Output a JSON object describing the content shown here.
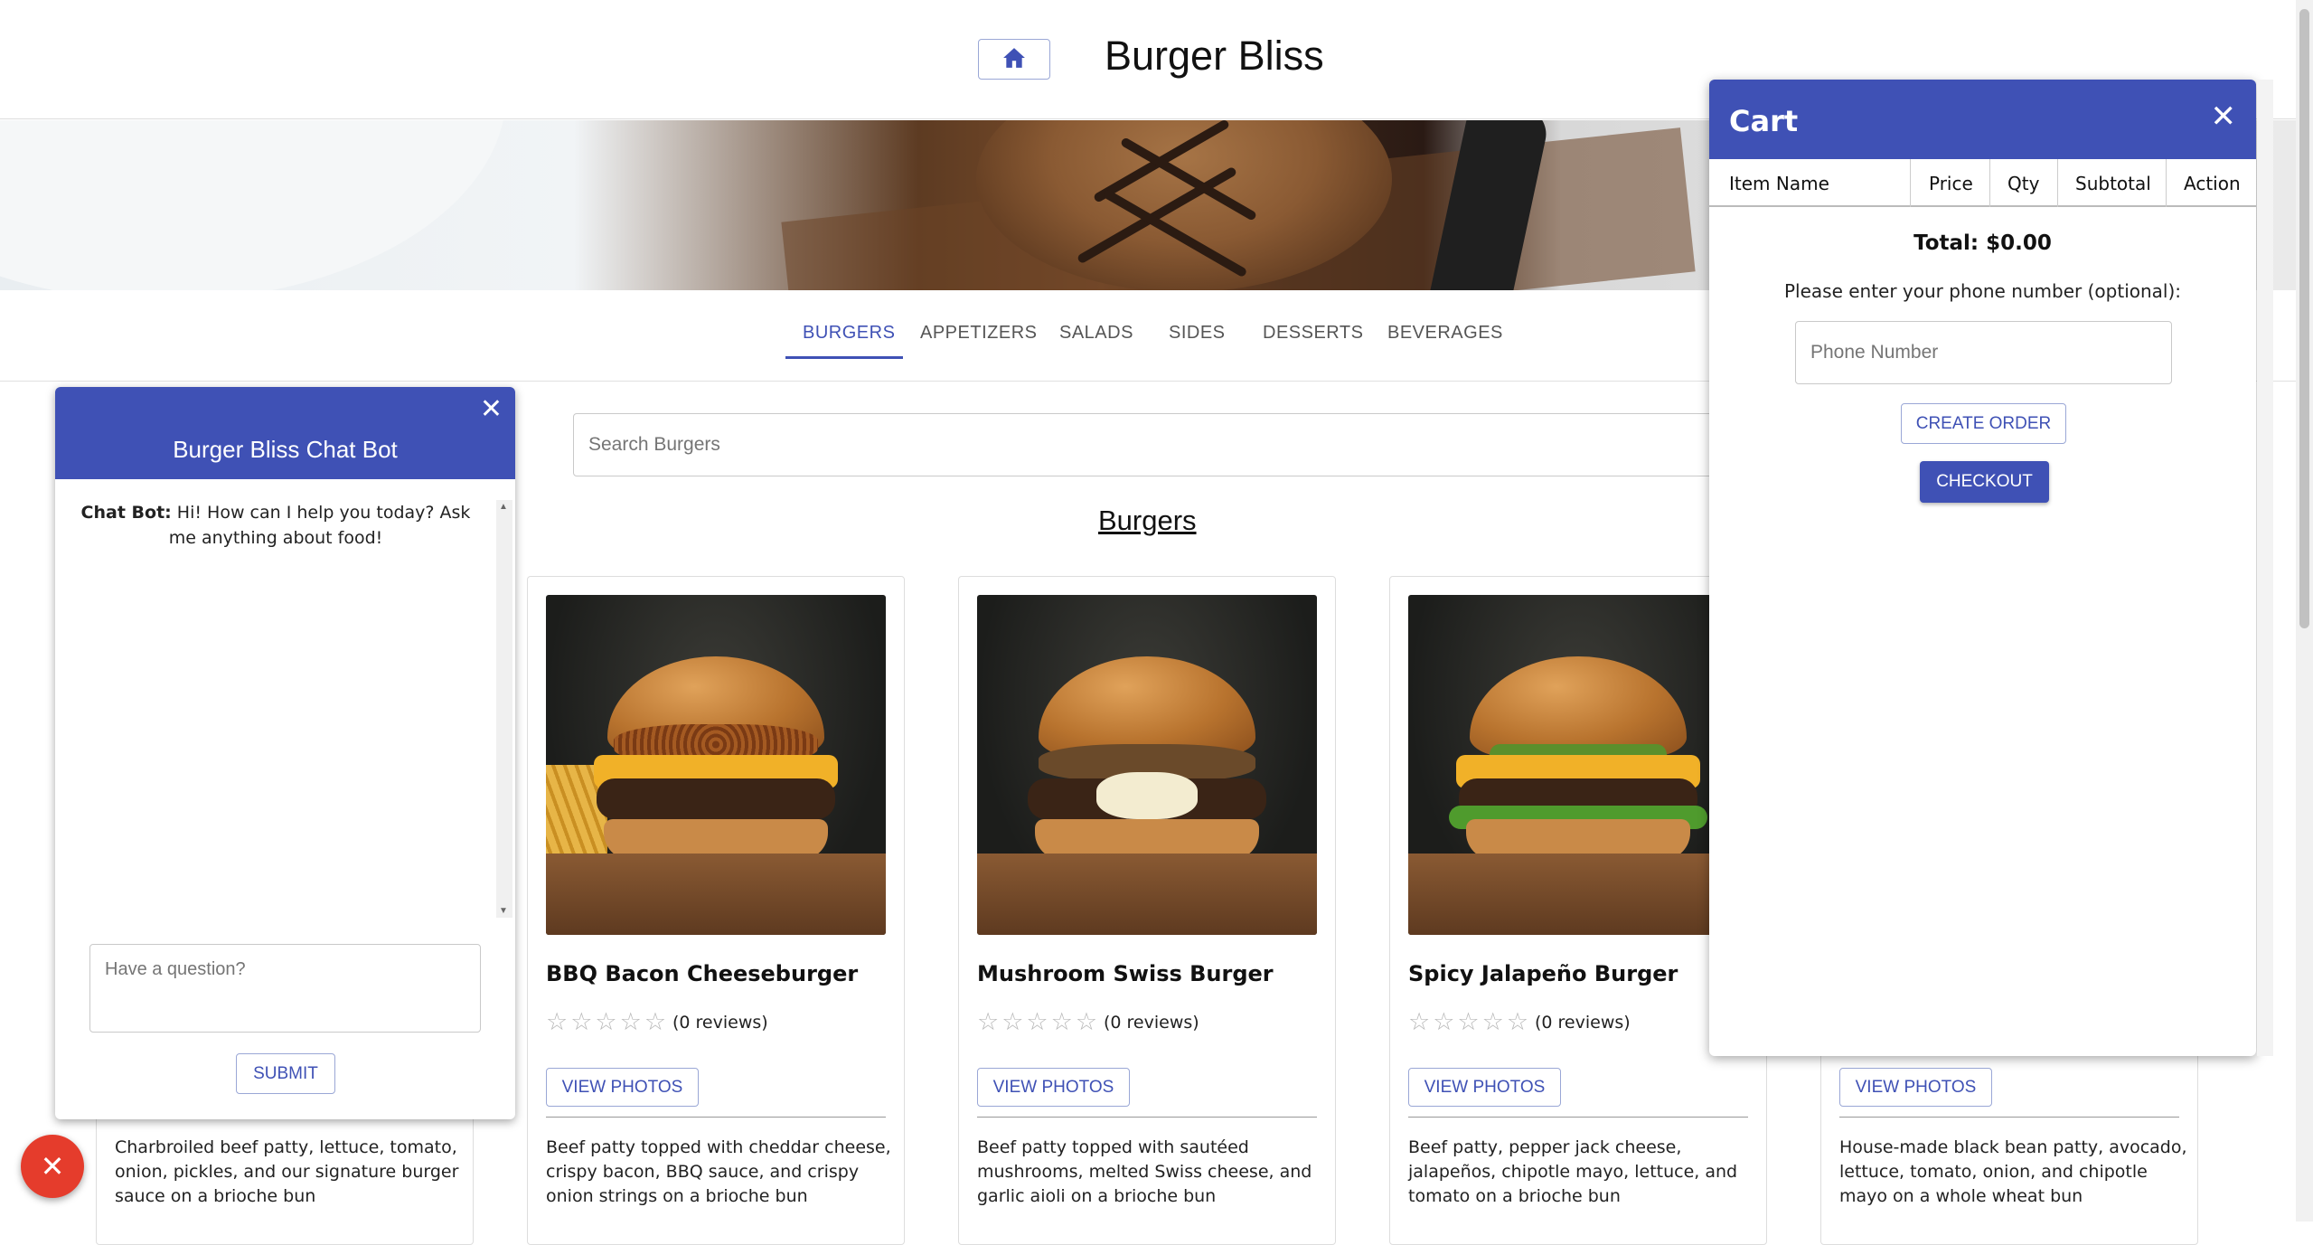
{
  "header": {
    "title": "Burger Bliss",
    "home_icon": "home-icon"
  },
  "tabs": [
    {
      "label": "BURGERS",
      "active": true
    },
    {
      "label": "APPETIZERS",
      "active": false
    },
    {
      "label": "SALADS",
      "active": false
    },
    {
      "label": "SIDES",
      "active": false
    },
    {
      "label": "DESSERTS",
      "active": false
    },
    {
      "label": "BEVERAGES",
      "active": false
    }
  ],
  "search": {
    "placeholder": "Search Burgers"
  },
  "section_title": "Burgers",
  "cards": [
    {
      "name": "",
      "reviews": "",
      "view_label": "",
      "desc": "Charbroiled beef patty, lettuce, tomato, onion, pickles, and our signature burger sauce on a brioche bun"
    },
    {
      "name": "BBQ Bacon Cheeseburger",
      "stars": "☆☆☆☆☆",
      "reviews": "(0 reviews)",
      "view_label": "VIEW PHOTOS",
      "desc": "Beef patty topped with cheddar cheese, crispy bacon, BBQ sauce, and crispy onion strings on a brioche bun"
    },
    {
      "name": "Mushroom Swiss Burger",
      "stars": "☆☆☆☆☆",
      "reviews": "(0 reviews)",
      "view_label": "VIEW PHOTOS",
      "desc": "Beef patty topped with sautéed mushrooms, melted Swiss cheese, and garlic aioli on a brioche bun"
    },
    {
      "name": "Spicy Jalapeño Burger",
      "stars": "☆☆☆☆☆",
      "reviews": "(0 reviews)",
      "view_label": "VIEW PHOTOS",
      "desc": "Beef patty, pepper jack cheese, jalapeños, chipotle mayo, lettuce, and tomato on a brioche bun"
    },
    {
      "name": "",
      "reviews": "",
      "view_label": "VIEW PHOTOS",
      "desc": "House-made black bean patty, avocado, lettuce, tomato, onion, and chipotle mayo on a whole wheat bun"
    }
  ],
  "chat": {
    "title": "Burger Bliss Chat Bot",
    "close": "✕",
    "speaker": "Chat Bot:",
    "message": " Hi! How can I help you today? Ask me anything about food!",
    "input_placeholder": "Have a question?",
    "submit_label": "SUBMIT"
  },
  "fab": {
    "icon": "close-icon",
    "glyph": "✕"
  },
  "cart": {
    "title": "Cart",
    "close": "✕",
    "columns": [
      "Item Name",
      "Price",
      "Qty",
      "Subtotal",
      "Action"
    ],
    "total": "Total: $0.00",
    "phone_label": "Please enter your phone number (optional):",
    "phone_placeholder": "Phone Number",
    "create_label": "CREATE ORDER",
    "checkout_label": "CHECKOUT"
  },
  "colors": {
    "primary": "#3f51b5",
    "fab": "#e53c2c"
  }
}
